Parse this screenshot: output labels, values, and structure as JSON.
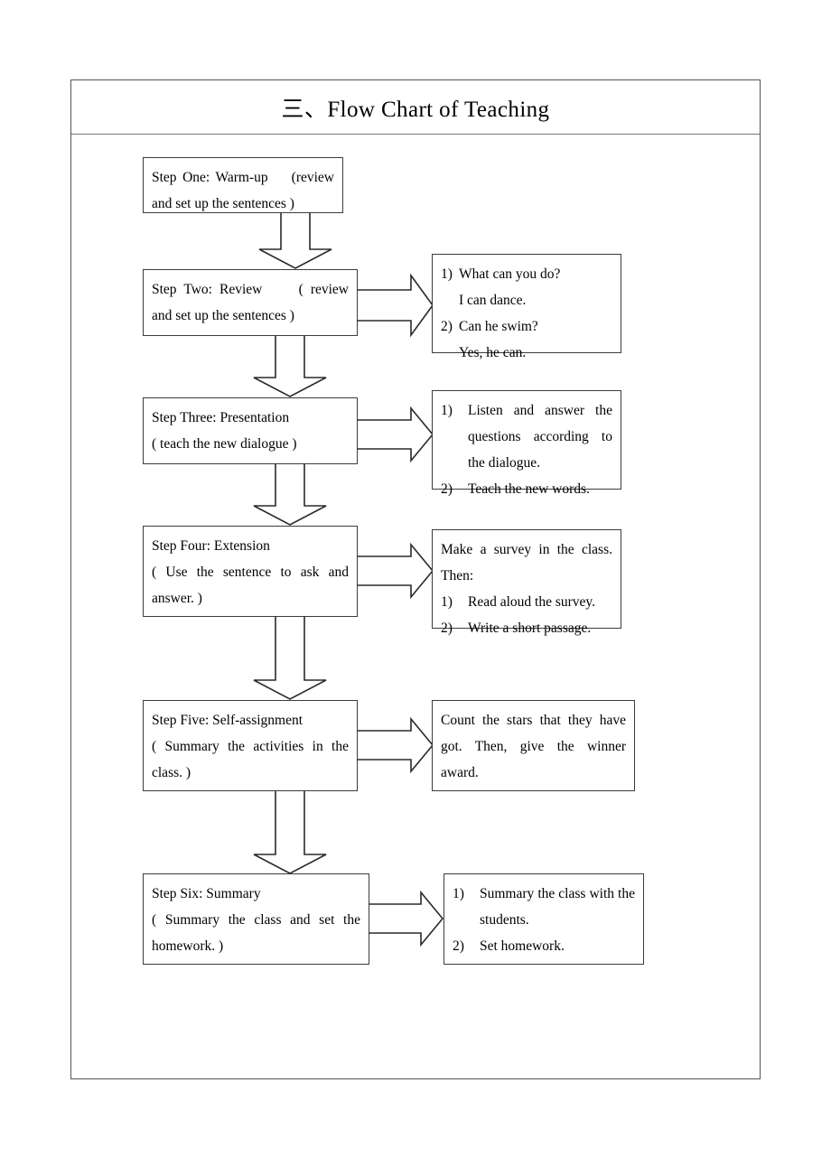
{
  "document": {
    "title": "三、Flow Chart of Teaching"
  },
  "flow": {
    "steps": [
      {
        "id": "step-one",
        "lines": [
          "Step One: Warm-up    (review",
          "and set up the sentences )"
        ],
        "detail": null
      },
      {
        "id": "step-two",
        "lines": [
          "Step Two: Review     ( review",
          "and set up the sentences )"
        ],
        "detail": {
          "id": "detail-step-two",
          "items": [
            {
              "marker": "1)",
              "text": "What can you do?"
            },
            {
              "marker": "",
              "text": "I can dance."
            },
            {
              "marker": "2)",
              "text": "Can he swim?"
            },
            {
              "marker": "",
              "text": "Yes, he can."
            }
          ]
        }
      },
      {
        "id": "step-three",
        "lines": [
          "Step Three: Presentation",
          "( teach the new dialogue )"
        ],
        "detail": {
          "id": "detail-step-three",
          "items": [
            {
              "marker": "1)",
              "text": "Listen and answer the questions according to the dialogue."
            },
            {
              "marker": "2)",
              "text": "Teach the new words."
            }
          ]
        }
      },
      {
        "id": "step-four",
        "lines": [
          "Step Four: Extension",
          "( Use the sentence to ask and",
          "answer. )"
        ],
        "detail": {
          "id": "detail-step-four",
          "intro": [
            "Make a survey in the class.",
            "Then:"
          ],
          "items": [
            {
              "marker": "1)",
              "text": "Read aloud the survey."
            },
            {
              "marker": "2)",
              "text": "Write a short passage."
            }
          ]
        }
      },
      {
        "id": "step-five",
        "lines": [
          "Step Five: Self-assignment",
          "( Summary the activities in the",
          "class. )"
        ],
        "detail": {
          "id": "detail-step-five",
          "paragraph": "Count the stars that they have got. Then, give the winner award."
        }
      },
      {
        "id": "step-six",
        "lines": [
          "Step Six: Summary",
          "( Summary the class and set the",
          "homework. )"
        ],
        "detail": {
          "id": "detail-step-six",
          "items": [
            {
              "marker": "1)",
              "text": "Summary the class with the students."
            },
            {
              "marker": "2)",
              "text": "Set homework."
            }
          ]
        }
      }
    ]
  },
  "colors": {
    "border": "#3c3c3c",
    "frame_border": "#555555",
    "arrow_stroke": "#2a2a2a",
    "text": "#000000",
    "background": "#ffffff"
  }
}
